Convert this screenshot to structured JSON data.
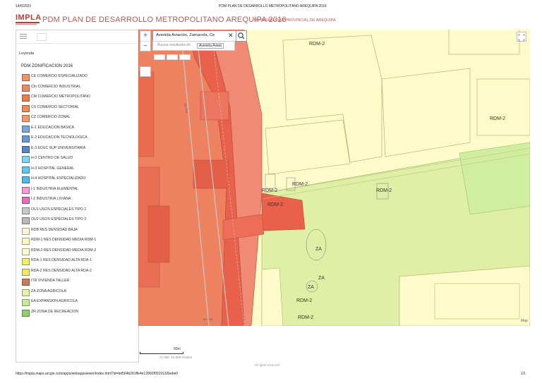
{
  "print_header": {
    "date": "14/6/2021",
    "page_title": "PDM PLAN DE DESARROLLO METROPOLITANO AREQUIPA 2016"
  },
  "print_footer": {
    "url": "https://impla.maps.arcgis.com/apps/webappviewer/index.html?id=bd564b261ffe4e12850f0019132bebe0",
    "page": "1/1"
  },
  "app": {
    "logo_text": "IMPLA",
    "title": "PDM PLAN DE DESARROLLO METROPOLITANO AREQUIPA 2016",
    "subtitle": "MUNICIPALIDAD PROVINCIAL DE AREQUIPA"
  },
  "search": {
    "value": "Avenida Aviación, Zamacola, Ce",
    "suggestion_prefix": "Buscar resultados de",
    "suggestion_highlight": "Avenida Aviaci"
  },
  "zoom": {
    "in": "+",
    "out": "−"
  },
  "legend": {
    "heading": "Leyenda",
    "layer_title": "PDM ZONIFICACION 2016",
    "items": [
      {
        "label": "CE COMERCIO ESPECIALIZADO",
        "color": "#f0956a"
      },
      {
        "label": "CIn COMERCIO INDUSTRIAL",
        "color": "#ee8a5e"
      },
      {
        "label": "CM COMERCIO METROPOLITANO",
        "color": "#ec7c4f"
      },
      {
        "label": "CS COMERCIO SECTORIAL",
        "color": "#f08a5a"
      },
      {
        "label": "CZ COMERCIO ZONAL",
        "color": "#f29a6a"
      },
      {
        "label": "E-1 EDUCACION BASICA",
        "color": "#7aa6d8"
      },
      {
        "label": "E-2 EDUCACION TECNOLOGICA",
        "color": "#6a97cf"
      },
      {
        "label": "E-3 EDUC SUP UNIVERSITARIA",
        "color": "#5a87c4"
      },
      {
        "label": "H-2 CENTRO DE SALUD",
        "color": "#7fd4f0"
      },
      {
        "label": "H-3 HOSPITAL GENERAL",
        "color": "#62c6ec"
      },
      {
        "label": "H-4 HOSPITAL ESPECIALIZADO",
        "color": "#4fb9e8"
      },
      {
        "label": "I-1 INDUSTRIA ELEMENTAL",
        "color": "#f29ad6"
      },
      {
        "label": "I-2 INDUSTRIA LIVIANA",
        "color": "#e86cc4"
      },
      {
        "label": "OU1 USOS ESPECIALES TIPO 1",
        "color": "#c8c8c8"
      },
      {
        "label": "OU2 USOS ESPECIALES TIPO 2",
        "color": "#b8b8b8"
      },
      {
        "label": "RDB RES DENSIDAD BAJA",
        "color": "#fcf3dc"
      },
      {
        "label": "RDM-1 RES DENSIDAD MEDIA RDM-1",
        "color": "#fbf7c2"
      },
      {
        "label": "RDM-2 RES DENSIDAD MEDIA RDM-2",
        "color": "#fdfbd1"
      },
      {
        "label": "RDA-1 RES DENSIDAD ALTA RDA-1",
        "color": "#eef06a"
      },
      {
        "label": "RDA-2 RES DENSIDAD ALTA RDA-2",
        "color": "#f3e76a"
      },
      {
        "label": "ITR VIVIENDA TALLER",
        "color": "#c97b5a"
      },
      {
        "label": "ZA ZONA AGRICOLA",
        "color": "#e3f3a8"
      },
      {
        "label": "EA EXPANSION AGRICOLA",
        "color": "#c6ec9a"
      },
      {
        "label": "ZR ZONA DE RECREACION",
        "color": "#8ed06a"
      }
    ]
  },
  "map": {
    "labels": {
      "rdm2_a": "RDM-2",
      "rdm2_b": "RDM-2",
      "rdm2_c": "RDM-2",
      "rdm2_d": "RDM-2",
      "rdm2_e": "RDM-2",
      "rdm2_f": "RDM-2",
      "rdm2_g": "RDM-2",
      "rdm2_h": "RDM-2",
      "za_a": "ZA",
      "za_b": "ZA",
      "za_c": "ZA",
      "road_a": "AV. 743",
      "road_b": "AV. 743",
      "esri": "Map"
    },
    "scale_label": "60m",
    "coords": "71.560 -16.368 Grados",
    "rights": "All rights reserved"
  }
}
